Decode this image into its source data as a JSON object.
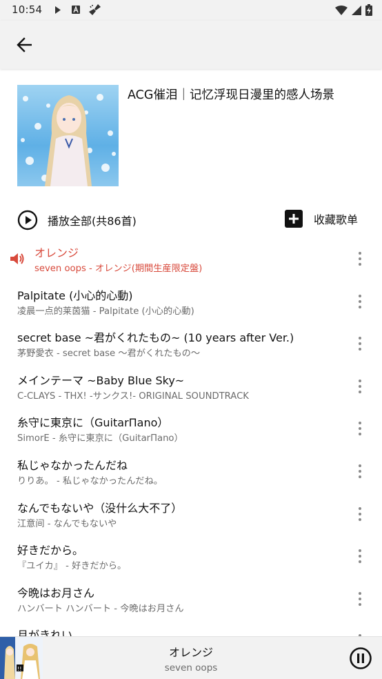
{
  "status_bar": {
    "time": "10:54",
    "icons": [
      "play-icon",
      "a-box-icon",
      "broom-icon",
      "wifi-icon",
      "signal-icon",
      "battery-charging-icon"
    ]
  },
  "app_bar": {
    "back_icon": "arrow-left-icon"
  },
  "playlist": {
    "title": "ACG催泪｜记忆浮现日漫里的感人场景",
    "play_all_label": "播放全部(共86首)",
    "collect_label": "收藏歌单"
  },
  "songs": [
    {
      "title": "オレンジ",
      "subtitle": "seven oops - オレンジ(期間生産限定盤)",
      "playing": true
    },
    {
      "title": "Palpitate (小心的心動)",
      "subtitle": "凌晨一点的莱茵猫 - Palpitate (小心的心動)"
    },
    {
      "title": "secret base ~君がくれたもの~ (10 years after Ver.)",
      "subtitle": "茅野愛衣 - secret base 〜君がくれたもの〜"
    },
    {
      "title": "メインテーマ ~Baby Blue Sky~",
      "subtitle": "C-CLAYS - THX! -サンクス!- ORIGINAL SOUNDTRACK"
    },
    {
      "title": "糸守に東京に（GuitarПano）",
      "subtitle": "SimorE - 糸守に東京に（GuitarПano）"
    },
    {
      "title": "私じゃなかったんだね",
      "subtitle": "りりあ。 - 私じゃなかったんだね。"
    },
    {
      "title": "なんでもないや（没什么大不了）",
      "subtitle": "江意间 - なんでもないや"
    },
    {
      "title": "好きだから。",
      "subtitle": "『ユイカ』 - 好きだから。"
    },
    {
      "title": "今晩はお月さん",
      "subtitle": "ハンバート ハンバート - 今晩はお月さん"
    },
    {
      "title": "月がきれい",
      "subtitle": ""
    }
  ],
  "now_playing": {
    "title": "オレンジ",
    "artist": "seven oops",
    "control_icon": "pause-circle-icon"
  },
  "colors": {
    "accent": "#d84a3c",
    "bar_background": "#f2f2f2",
    "secondary_text": "#6b6b6b"
  }
}
